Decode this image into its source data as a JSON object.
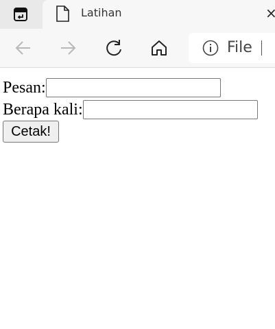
{
  "browser": {
    "tab": {
      "title": "Latihan",
      "close_glyph": "×"
    },
    "address": {
      "scheme_label": "File"
    },
    "icons": [
      "tab-actions-icon",
      "document-icon",
      "back-arrow-icon",
      "forward-arrow-icon",
      "refresh-icon",
      "home-icon",
      "info-icon"
    ]
  },
  "form": {
    "pesan_label": "Pesan:",
    "pesan_value": "",
    "jumlah_label": "Berapa kali:",
    "jumlah_value": "",
    "submit_label": "Cetak!"
  }
}
